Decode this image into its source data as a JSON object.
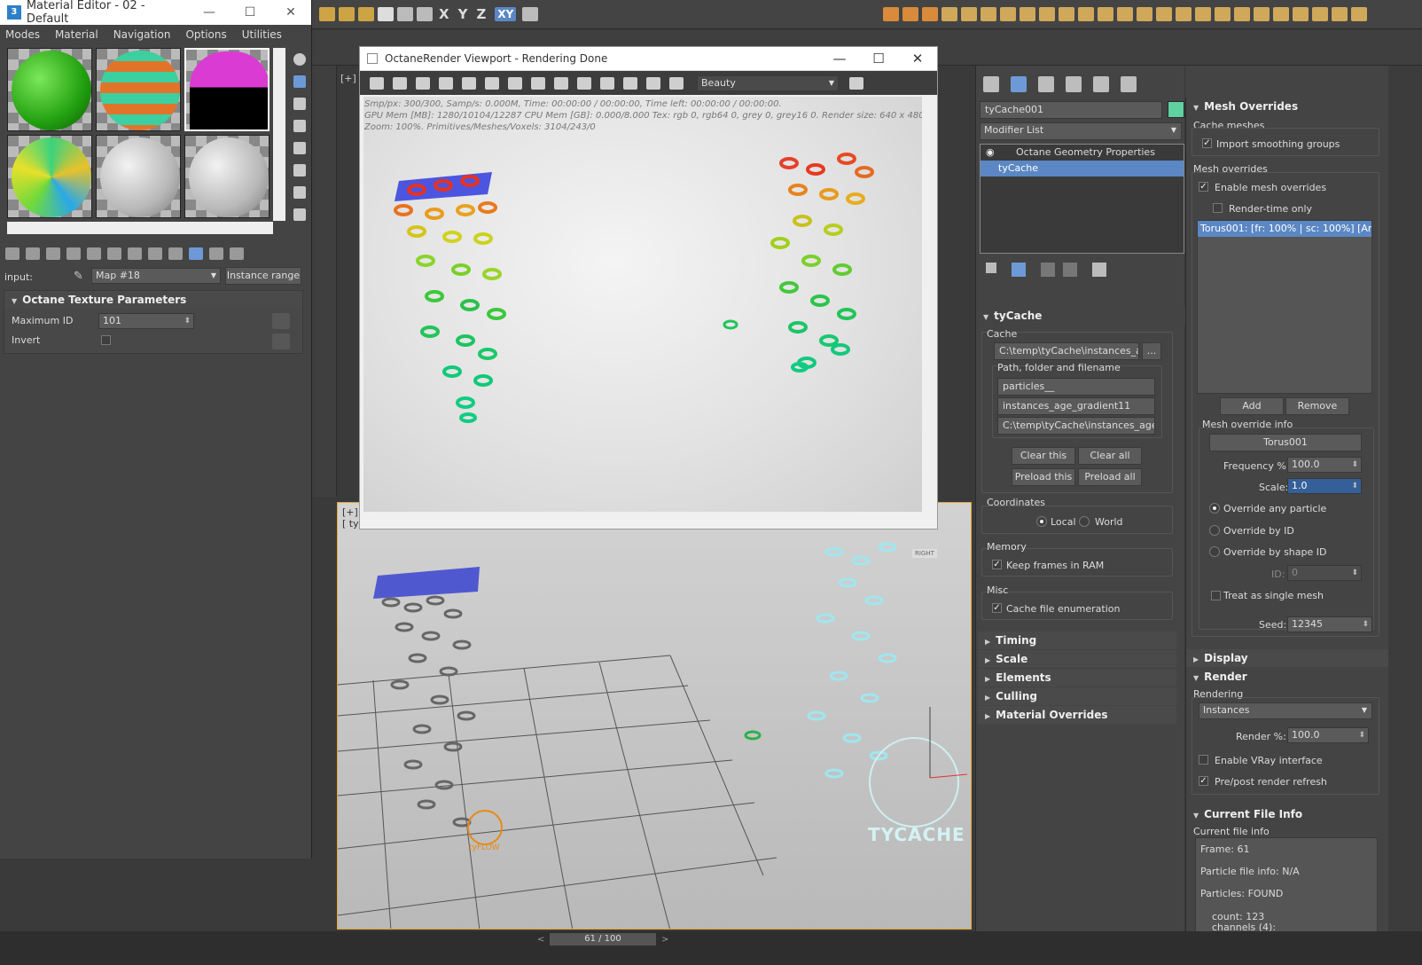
{
  "material_editor": {
    "title": "Material Editor - 02 - Default",
    "logo": "3",
    "menu": [
      "Modes",
      "Material",
      "Navigation",
      "Options",
      "Utilities"
    ],
    "input_label": "input:",
    "map_select": "Map #18",
    "instance_range_button": "Instance range",
    "rollout_title": "Octane Texture Parameters",
    "maximum_id_label": "Maximum ID",
    "maximum_id_value": "101",
    "invert_label": "Invert"
  },
  "toolbar": {
    "axis_x": "X",
    "axis_y": "Y",
    "axis_z": "Z",
    "axis_xy": "XY"
  },
  "octane": {
    "title": "OctaneRender Viewport - Rendering Done",
    "pass_select": "Beauty",
    "stats_line1": "Smp/px: 300/300,   Samp/s: 0.000M,   Time: 00:00:00 / 00:00:00,   Time left: 00:00:00 / 00:00:00.",
    "stats_line2": "GPU Mem [MB]: 1280/10104/12287   CPU Mem [GB]: 0.000/8.000   Tex: rgb 0, rgb64 0, grey 0, grey16 0.   Render size: 640 x 480.",
    "stats_line3": "Zoom: 100%.   Primitives/Meshes/Voxels: 3104/243/0"
  },
  "viewport_top": {
    "label": "[+]"
  },
  "viewport": {
    "label_1": "[+]",
    "label_2": "[ tyFlow ]",
    "view_cube": "RIGHT",
    "logo_text": "TYCACHE",
    "tyflow_text": "tyFLOW"
  },
  "command_panel": {
    "object_name": "tyCache001",
    "object_color": "#5fd0a0",
    "modifier_list": "Modifier List",
    "stack": [
      "Octane Geometry Properties",
      "tyCache"
    ],
    "tycache_title": "tyCache",
    "cache_label": "Cache",
    "cache_path": "C:\\temp\\tyCache\\instances_age_",
    "browse_button": "...",
    "path_group_label": "Path, folder and filename",
    "folder": "particles__",
    "filename": "instances_age_gradient11",
    "full_path": "C:\\temp\\tyCache\\instances_age_gra",
    "clear_this": "Clear this",
    "clear_all": "Clear all",
    "preload_this": "Preload this",
    "preload_all": "Preload all",
    "coordinates_label": "Coordinates",
    "local_label": "Local",
    "world_label": "World",
    "memory_label": "Memory",
    "keep_frames_label": "Keep frames in RAM",
    "misc_label": "Misc",
    "cache_enum_label": "Cache file enumeration",
    "rollouts": [
      "Timing",
      "Scale",
      "Elements",
      "Culling",
      "Material Overrides"
    ]
  },
  "right_panel": {
    "mesh_overrides_title": "Mesh Overrides",
    "cache_meshes_label": "Cache meshes",
    "import_smoothing_label": "Import smoothing groups",
    "mesh_overrides_label": "Mesh overrides",
    "enable_overrides_label": "Enable mesh overrides",
    "render_time_only_label": "Render-time only",
    "override_item": "Torus001: [fr: 100% | sc: 100%] [Any]",
    "add_button": "Add",
    "remove_button": "Remove",
    "override_info_label": "Mesh override info",
    "torus_button": "Torus001",
    "frequency_label": "Frequency %:",
    "frequency_value": "100.0",
    "scale_label": "Scale:",
    "scale_value": "1.0",
    "override_any_label": "Override any particle",
    "override_id_label": "Override by ID",
    "override_shape_label": "Override by shape ID",
    "id_label": "ID:",
    "id_value": "0",
    "single_mesh_label": "Treat as single mesh",
    "seed_label": "Seed:",
    "seed_value": "12345",
    "display_title": "Display",
    "render_title": "Render",
    "rendering_label": "Rendering",
    "rendering_select": "Instances",
    "render_pct_label": "Render %:",
    "render_pct_value": "100.0",
    "vray_label": "Enable VRay interface",
    "prepost_label": "Pre/post render refresh",
    "file_info_title": "Current File Info",
    "file_info_label": "Current file info",
    "frame_text": "Frame: 61",
    "particle_file_text": "Particle file info: N/A",
    "particles_text": "Particles: FOUND",
    "count_text": "count: 123",
    "channels_text": "channels (4):"
  },
  "timeline": {
    "frame_display": "61 / 100"
  }
}
